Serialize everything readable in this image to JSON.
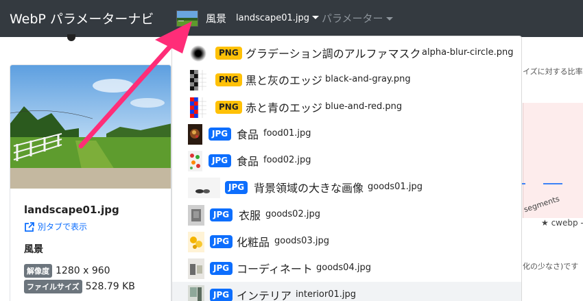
{
  "navbar": {
    "brand": "WebP パラメーターナビ",
    "category": "風景",
    "file": "landscape01.jpg",
    "params": "パラメーター"
  },
  "card": {
    "title": "landscape01.jpg",
    "open_new_tab": "別タブで表示",
    "category": "風景",
    "resolution_label": "解像度",
    "resolution": "1280 x 960",
    "filesize_label": "ファイルサイズ",
    "filesize": "528.79 KB"
  },
  "background": {
    "right_text1": "イズに対する比率",
    "segments_text": "segments",
    "cwebp_text": "★ cwebp -p",
    "right_text2": "化の少なさ)です"
  },
  "dropdown": {
    "items": [
      {
        "type": "PNG",
        "label": "グラデーション調のアルファマスク",
        "file": "alpha-blur-circle.png",
        "thumb": "alpha-blur-circle"
      },
      {
        "type": "PNG",
        "label": "黒と灰のエッジ",
        "file": "black-and-gray.png",
        "thumb": "black-gray-check"
      },
      {
        "type": "PNG",
        "label": "赤と青のエッジ",
        "file": "blue-and-red.png",
        "thumb": "red-blue-check"
      },
      {
        "type": "JPG",
        "label": "食品",
        "file": "food01.jpg",
        "thumb": "food01"
      },
      {
        "type": "JPG",
        "label": "食品",
        "file": "food02.jpg",
        "thumb": "food02"
      },
      {
        "type": "JPG",
        "label": "背景領域の大きな画像",
        "file": "goods01.jpg",
        "thumb": "goods01"
      },
      {
        "type": "JPG",
        "label": "衣服",
        "file": "goods02.jpg",
        "thumb": "goods02"
      },
      {
        "type": "JPG",
        "label": "化粧品",
        "file": "goods03.jpg",
        "thumb": "goods03"
      },
      {
        "type": "JPG",
        "label": "コーディネート",
        "file": "goods04.jpg",
        "thumb": "goods04"
      },
      {
        "type": "JPG",
        "label": "インテリア",
        "file": "interior01.jpg",
        "thumb": "interior01"
      }
    ]
  },
  "colors": {
    "navbar": "#343a40",
    "png_badge": "#ffc107",
    "jpg_badge": "#0d6efd",
    "arrow": "#ff2d78",
    "link": "#0d6efd"
  }
}
